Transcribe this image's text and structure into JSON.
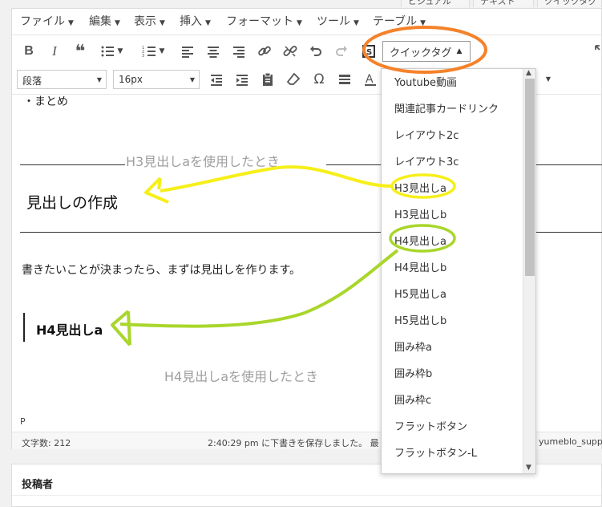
{
  "top_tabs": [
    "ビジュアル",
    "テキスト",
    "クイックタグ"
  ],
  "menubar": [
    {
      "label": "ファイル"
    },
    {
      "label": "編集"
    },
    {
      "label": "表示"
    },
    {
      "label": "挿入"
    },
    {
      "label": "フォーマット"
    },
    {
      "label": "ツール"
    },
    {
      "label": "テーブル"
    }
  ],
  "toolbar": {
    "bold": "B",
    "italic": "I",
    "quote": "❝",
    "omega": "Ω",
    "quicktag_label": "クイックタグ",
    "quicktag_arrow": "▲",
    "format_value": "段落",
    "font_size_value": "16px"
  },
  "content": {
    "bullet_text": "・まとめ",
    "annotation_h3": "H3見出しaを使用したとき",
    "heading3": "見出しの作成",
    "paragraph": "書きたいことが決まったら、まずは見出しを作ります。",
    "heading4": "H4見出しa",
    "annotation_h4": "H4見出しaを使用したとき"
  },
  "status": {
    "path": "P",
    "word_count": "文字数: 212",
    "save_message": "2:40:29 pm に下書きを保存しました。 最",
    "extra": "yumeblo_supp"
  },
  "author_box": {
    "title": "投稿者"
  },
  "dropdown_items": [
    "Youtube動画",
    "関連記事カードリンク",
    "レイアウト2c",
    "レイアウト3c",
    "H3見出しa",
    "H3見出しb",
    "H4見出しa",
    "H4見出しb",
    "H5見出しa",
    "H5見出しb",
    "囲み枠a",
    "囲み枠b",
    "囲み枠c",
    "フラットボタン",
    "フラットボタン-L"
  ],
  "annotation_colors": {
    "orange": "#f5822a",
    "yellow": "#f6ef1a",
    "green": "#a9d62b"
  }
}
